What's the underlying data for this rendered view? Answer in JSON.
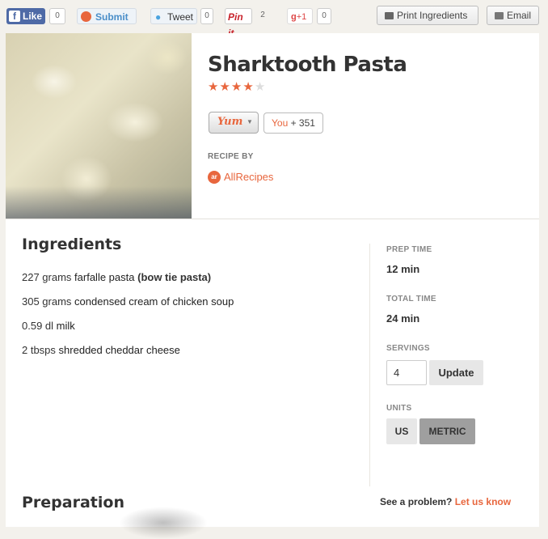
{
  "share": {
    "facebook": {
      "label": "Like",
      "count": "0"
    },
    "stumble": {
      "label": "Submit"
    },
    "twitter": {
      "label": "Tweet",
      "count": "0"
    },
    "pinterest": {
      "label": "Pin it",
      "count": "2"
    },
    "gplus": {
      "label": "+1",
      "count": "0"
    },
    "print_label": "Print Ingredients",
    "email_label": "Email"
  },
  "recipe": {
    "title": "Sharktooth Pasta",
    "rating": 4,
    "rating_max": 5,
    "yum_label": "Yum",
    "yum_you": "You",
    "yum_count": "+ 351",
    "recipe_by_label": "RECIPE BY",
    "source": "AllRecipes"
  },
  "ingredients": {
    "heading": "Ingredients",
    "items": [
      {
        "amount": "227 grams",
        "name": "farfalle pasta",
        "note": "(bow tie pasta)"
      },
      {
        "amount": "305 grams",
        "name": "condensed cream of chicken soup",
        "note": ""
      },
      {
        "amount": "0.59 dl",
        "name": "milk",
        "note": ""
      },
      {
        "amount": "2 tbsps",
        "name": "shredded cheddar cheese",
        "note": ""
      }
    ]
  },
  "details": {
    "prep_label": "PREP TIME",
    "prep_value": "12 min",
    "total_label": "TOTAL TIME",
    "total_value": "24 min",
    "servings_label": "SERVINGS",
    "servings_value": "4",
    "update_label": "Update",
    "units_label": "UNITS",
    "units": [
      "US",
      "METRIC"
    ],
    "selected_unit": "METRIC"
  },
  "preparation": {
    "heading": "Preparation",
    "problem_text": "See a problem?",
    "problem_link": "Let us know"
  },
  "colors": {
    "accent": "#e8663d",
    "facebook": "#4e6aa6"
  }
}
